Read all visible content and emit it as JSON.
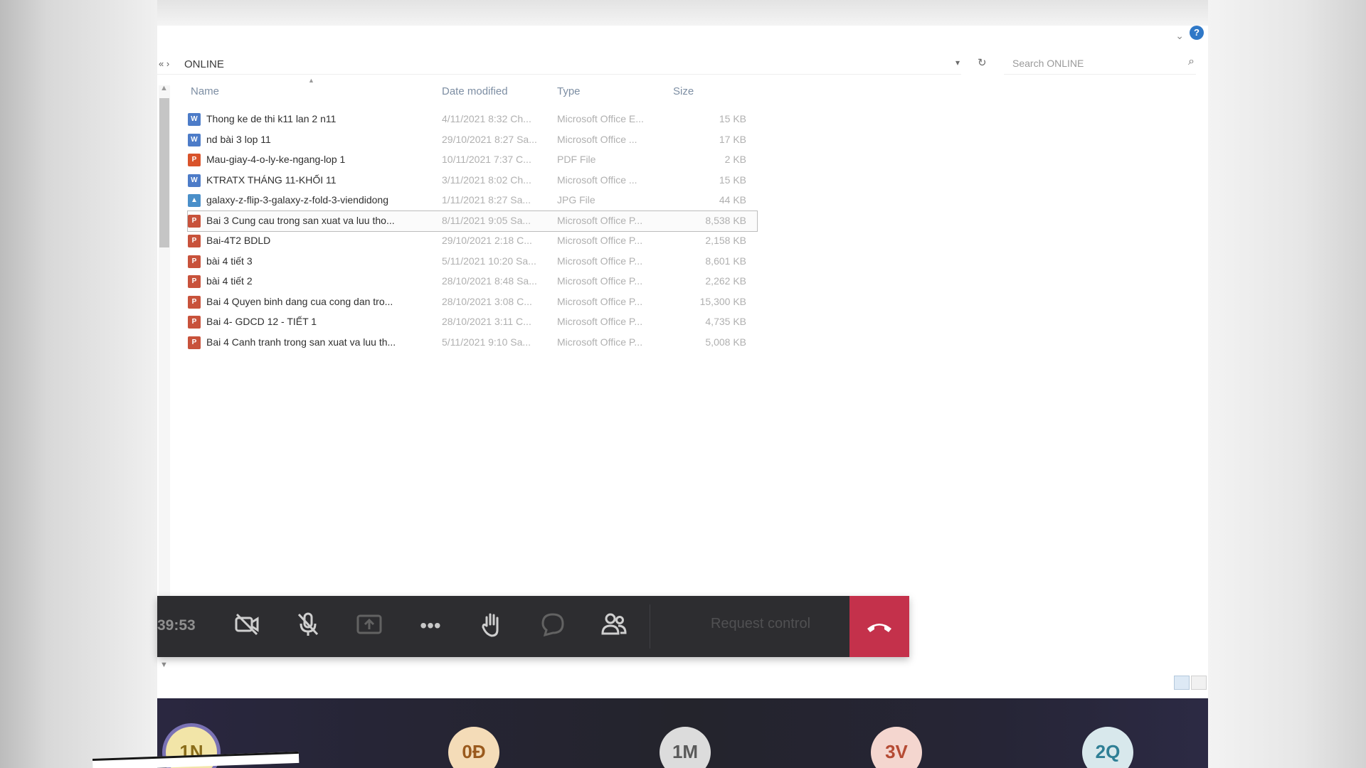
{
  "explorer": {
    "address_prefix": "«  ›",
    "address_current": "ONLINE",
    "search_placeholder": "Search ONLINE",
    "columns": {
      "name": "Name",
      "date": "Date modified",
      "type": "Type",
      "size": "Size"
    },
    "files": [
      {
        "name": "Thong ke de thi k11 lan 2 n11",
        "date": "4/11/2021 8:32 Ch...",
        "type": "Microsoft Office E...",
        "size": "15 KB",
        "icon_color": "#4d7cc8",
        "icon_glyph": "W"
      },
      {
        "name": "nd bài 3 lop 11",
        "date": "29/10/2021 8:27 Sa...",
        "type": "Microsoft Office ...",
        "size": "17 KB",
        "icon_color": "#4d7cc8",
        "icon_glyph": "W"
      },
      {
        "name": "Mau-giay-4-o-ly-ke-ngang-lop 1",
        "date": "10/11/2021 7:37 C...",
        "type": "PDF File",
        "size": "2 KB",
        "icon_color": "#d9532b",
        "icon_glyph": "P"
      },
      {
        "name": "KTRATX THÁNG 11-KHỐI 11",
        "date": "3/11/2021 8:02 Ch...",
        "type": "Microsoft Office ...",
        "size": "15 KB",
        "icon_color": "#4d7cc8",
        "icon_glyph": "W"
      },
      {
        "name": "galaxy-z-flip-3-galaxy-z-fold-3-viendidong",
        "date": "1/11/2021 8:27 Sa...",
        "type": "JPG File",
        "size": "44 KB",
        "icon_color": "#4a8fc9",
        "icon_glyph": "▲"
      },
      {
        "name": "Bai 3 Cung  cau trong san xuat va luu tho...",
        "date": "8/11/2021 9:05 Sa...",
        "type": "Microsoft Office P...",
        "size": "8,538 KB",
        "icon_color": "#c8523b",
        "icon_glyph": "P"
      },
      {
        "name": "Bai-4T2 BDLD",
        "date": "29/10/2021 2:18 C...",
        "type": "Microsoft Office P...",
        "size": "2,158 KB",
        "icon_color": "#c8523b",
        "icon_glyph": "P"
      },
      {
        "name": "bài 4 tiết 3",
        "date": "5/11/2021 10:20 Sa...",
        "type": "Microsoft Office P...",
        "size": "8,601 KB",
        "icon_color": "#c8523b",
        "icon_glyph": "P"
      },
      {
        "name": "bài 4 tiết 2",
        "date": "28/10/2021 8:48 Sa...",
        "type": "Microsoft Office P...",
        "size": "2,262 KB",
        "icon_color": "#c8523b",
        "icon_glyph": "P"
      },
      {
        "name": "Bai 4 Quyen binh dang cua cong dan tro...",
        "date": "28/10/2021 3:08 C...",
        "type": "Microsoft Office P...",
        "size": "15,300 KB",
        "icon_color": "#c8523b",
        "icon_glyph": "P"
      },
      {
        "name": "Bai 4- GDCD 12 - TIẾT 1",
        "date": "28/10/2021 3:11 C...",
        "type": "Microsoft Office P...",
        "size": "4,735 KB",
        "icon_color": "#c8523b",
        "icon_glyph": "P"
      },
      {
        "name": "Bai 4 Canh tranh trong san xuat va luu th...",
        "date": "5/11/2021 9:10 Sa...",
        "type": "Microsoft Office P...",
        "size": "5,008 KB",
        "icon_color": "#c8523b",
        "icon_glyph": "P"
      }
    ],
    "selected_index": 5
  },
  "meeting_bar": {
    "timer": "39:53",
    "icons": {
      "camera": "camera-off-icon",
      "mic": "mic-off-icon",
      "share": "share-screen-icon",
      "more": "more-actions-icon",
      "hand": "raise-hand-icon",
      "chat": "chat-icon",
      "people": "participants-icon",
      "leave": "phone-hang-up-icon"
    },
    "request_control": "Request control",
    "leave_color": "#c4314b"
  },
  "participants": [
    {
      "initials": "1N",
      "bg": "#f2e5a8",
      "fg": "#8a6d1a",
      "active": true
    },
    {
      "initials": "0Đ",
      "bg": "#f4dcb8",
      "fg": "#9a5a1d",
      "active": false
    },
    {
      "initials": "1M",
      "bg": "#dcdcdc",
      "fg": "#5a5a5a",
      "active": false
    },
    {
      "initials": "3V",
      "bg": "#f4d6cf",
      "fg": "#b54b34",
      "active": false
    },
    {
      "initials": "2Q",
      "bg": "#d8e8ec",
      "fg": "#2f7f95",
      "active": false
    }
  ]
}
